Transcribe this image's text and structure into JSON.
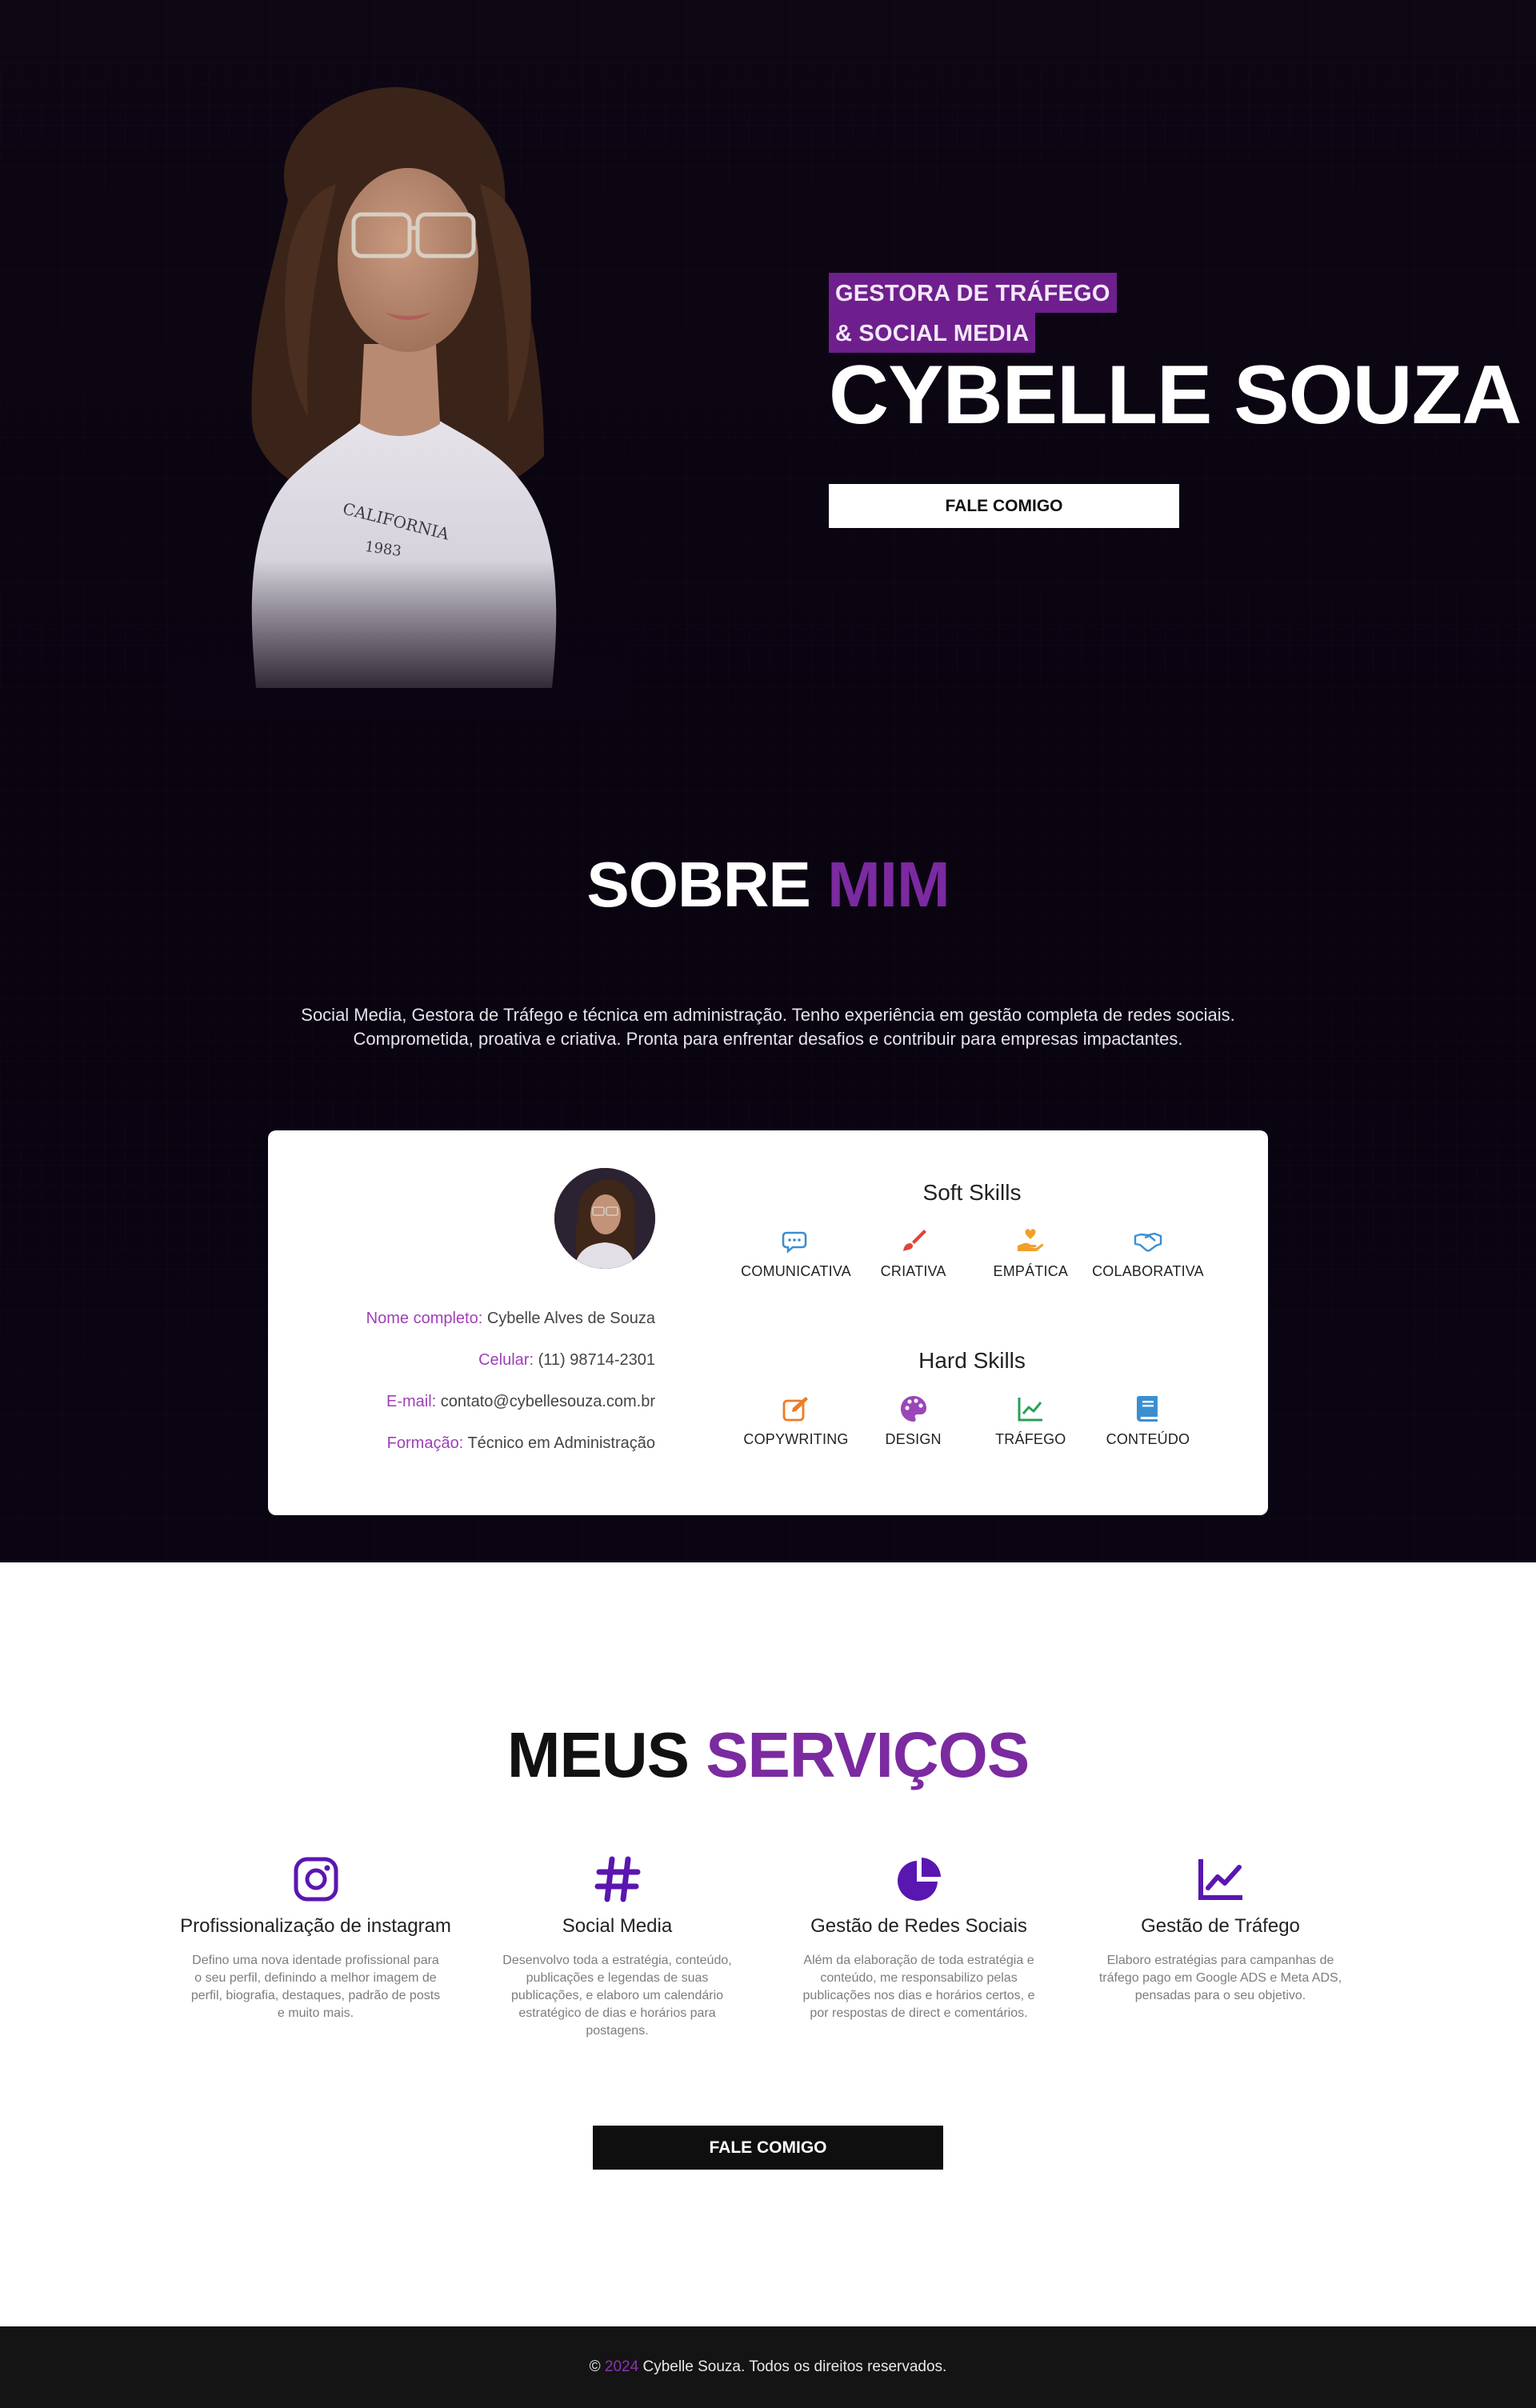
{
  "colors": {
    "accent": "#7b2aa0",
    "tag_bg": "#6e1f8d",
    "dark_bg": "#0b0412",
    "footer_bg": "#141414"
  },
  "hero": {
    "tag_line1": "GESTORA DE TRÁFEGO",
    "tag_line2": "& SOCIAL MEDIA",
    "name": "CYBELLE SOUZA",
    "cta": "FALE COMIGO",
    "photo_icon": "portrait-photo"
  },
  "about": {
    "title_main": "SOBRE",
    "title_accent": "MIM",
    "text_line1": "Social Media, Gestora de Tráfego e técnica em administração. Tenho experiência em gestão completa de redes sociais.",
    "text_line2": "Comprometida, proativa e criativa. Pronta para enfrentar desafios e contribuir para empresas impactantes.",
    "info": [
      {
        "key": "Nome completo:",
        "value": "Cybelle Alves de Souza"
      },
      {
        "key": "Celular:",
        "value": "(11) 98714-2301"
      },
      {
        "key": "E-mail:",
        "value": "contato@cybellesouza.com.br"
      },
      {
        "key": "Formação:",
        "value": "Técnico em Administração"
      }
    ],
    "soft_title": "Soft Skills",
    "soft_skills": [
      {
        "label": "COMUNICATIVA",
        "icon": "chat-bubbles-icon",
        "color": "#3a8fd1"
      },
      {
        "label": "CRIATIVA",
        "icon": "paintbrush-icon",
        "color": "#e0443a"
      },
      {
        "label": "EMPÁTICA",
        "icon": "hand-heart-icon",
        "color": "#f0a02a"
      },
      {
        "label": "COLABORATIVA",
        "icon": "handshake-icon",
        "color": "#3a8fd1"
      }
    ],
    "hard_title": "Hard Skills",
    "hard_skills": [
      {
        "label": "COPYWRITING",
        "icon": "pen-square-icon",
        "color": "#ef7b24"
      },
      {
        "label": "DESIGN",
        "icon": "palette-icon",
        "color": "#9b46b8"
      },
      {
        "label": "TRÁFEGO",
        "icon": "line-chart-icon",
        "color": "#2aa057"
      },
      {
        "label": "CONTEÚDO",
        "icon": "book-icon",
        "color": "#3a8fd1"
      }
    ]
  },
  "services": {
    "title_main": "MEUS",
    "title_accent": "SERVIÇOS",
    "items": [
      {
        "title": "Profissionalização de instagram",
        "icon": "instagram-icon",
        "desc": "Defino uma nova identade profissional para o seu perfil, definindo a melhor imagem de perfil, biografia, destaques, padrão de posts e muito mais."
      },
      {
        "title": "Social Media",
        "icon": "hashtag-icon",
        "desc": "Desenvolvo toda a estratégia, conteúdo, publicações e legendas de suas publicações, e elaboro um calendário estratégico de dias e horários para postagens."
      },
      {
        "title": "Gestão de Redes Sociais",
        "icon": "pie-chart-icon",
        "desc": "Além da elaboração de toda estratégia e conteúdo, me responsabilizo pelas publicações nos dias e horários certos, e por respostas de direct e comentários."
      },
      {
        "title": "Gestão de Tráfego",
        "icon": "line-chart-icon",
        "desc": "Elaboro estratégias para campanhas de tráfego pago em Google ADS e Meta ADS, pensadas para o seu objetivo."
      }
    ],
    "cta": "FALE COMIGO"
  },
  "footer": {
    "copy": "©",
    "year": "2024",
    "text": "Cybelle Souza. Todos os direitos reservados."
  }
}
